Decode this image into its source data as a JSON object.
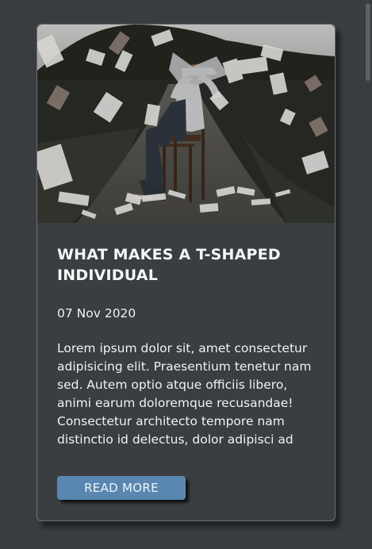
{
  "card": {
    "image_description": "photo-man-in-chair-with-flying-papers",
    "title": "What makes a T-shaped individual",
    "date": "07 Nov 2020",
    "excerpt": "Lorem ipsum dolor sit, amet consectetur adipisicing elit. Praesentium tenetur nam sed. Autem optio atque officiis libero, animi earum doloremque recusandae! Consectetur architecto tempore nam distinctio id delectus, dolor adipisci ad obcaecati dolorum.",
    "button_label": "Read more"
  },
  "colors": {
    "page_background": "#3a3d40",
    "card_background": "#3b3e41",
    "card_border": "#6c7075",
    "button_background": "#5a87b1",
    "text": "#eef0f2"
  }
}
